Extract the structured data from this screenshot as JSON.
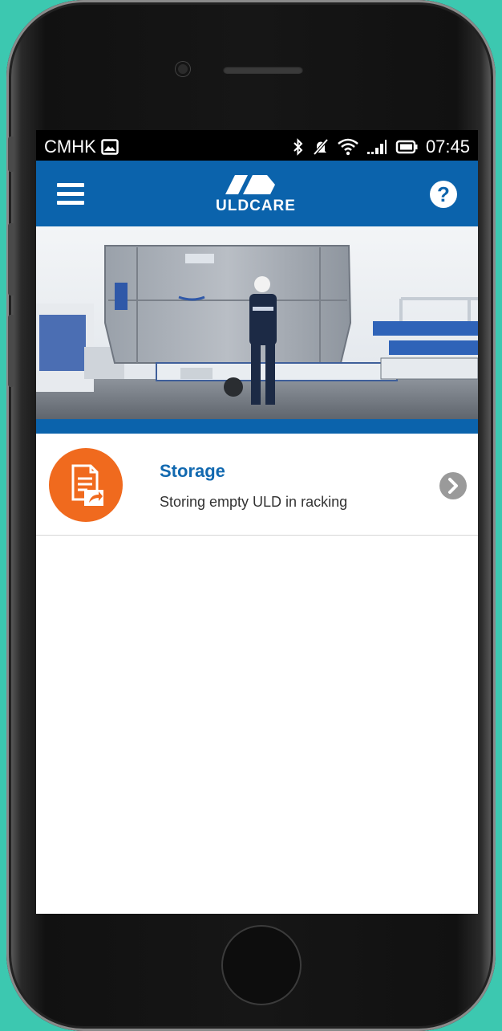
{
  "status_bar": {
    "carrier": "CMHK",
    "time": "07:45",
    "icons": [
      "image-icon",
      "bluetooth-icon",
      "mute-icon",
      "wifi-icon",
      "signal-icon",
      "battery-icon"
    ]
  },
  "app_bar": {
    "logo_text": "ULDCARE",
    "icons": [
      "menu-icon",
      "help-icon"
    ],
    "color": "#0b63ac"
  },
  "list": {
    "items": [
      {
        "title": "Storage",
        "subtitle": "Storing empty ULD in racking",
        "icon": "document-share-icon",
        "icon_color": "#f06a1e"
      }
    ]
  }
}
